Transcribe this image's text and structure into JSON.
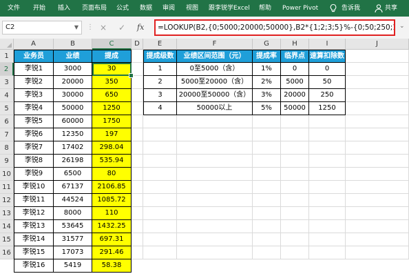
{
  "ribbon": {
    "tabs": [
      "文件",
      "开始",
      "插入",
      "页面布局",
      "公式",
      "数据",
      "审阅",
      "视图",
      "跟李锐学Excel",
      "帮助",
      "Power Pivot"
    ],
    "tell_me": "告诉我",
    "share": "共享",
    "color": "#217346"
  },
  "formula_bar": {
    "name_box": "C2",
    "cancel_icon": "×",
    "confirm_icon": "✓",
    "fx_label": "fx",
    "formula": "=LOOKUP(B2,{0;5000;20000;50000},B2*{1;2;3;5}%-{0;50;250;1250})"
  },
  "columns": [
    "A",
    "B",
    "C",
    "D",
    "E",
    "F",
    "G",
    "H",
    "I",
    "J"
  ],
  "rows": [
    "1",
    "2",
    "3",
    "4",
    "5",
    "6",
    "7",
    "8",
    "9",
    "10",
    "11",
    "12",
    "13",
    "14",
    "15",
    "16"
  ],
  "table1": {
    "headers": [
      "业务员",
      "业绩",
      "提成"
    ],
    "data": [
      [
        "李锐1",
        "3000",
        "30"
      ],
      [
        "李锐2",
        "20000",
        "350"
      ],
      [
        "李锐3",
        "30000",
        "650"
      ],
      [
        "李锐4",
        "50000",
        "1250"
      ],
      [
        "李锐5",
        "60000",
        "1750"
      ],
      [
        "李锐6",
        "12350",
        "197"
      ],
      [
        "李锐7",
        "17402",
        "298.04"
      ],
      [
        "李锐8",
        "26198",
        "535.94"
      ],
      [
        "李锐9",
        "6500",
        "80"
      ],
      [
        "李锐10",
        "67137",
        "2106.85"
      ],
      [
        "李锐11",
        "44524",
        "1085.72"
      ],
      [
        "李锐12",
        "8000",
        "110"
      ],
      [
        "李锐13",
        "53645",
        "1432.25"
      ],
      [
        "李锐14",
        "31577",
        "697.31"
      ],
      [
        "李锐15",
        "17073",
        "291.46"
      ],
      [
        "李锐16",
        "5419",
        "58.38"
      ]
    ]
  },
  "table2": {
    "headers": [
      "提成级数",
      "业绩区间范围（元）",
      "提成率",
      "临界点",
      "速算扣除数"
    ],
    "data": [
      [
        "1",
        "0至5000（含）",
        "1%",
        "0",
        "0"
      ],
      [
        "2",
        "5000至20000（含）",
        "2%",
        "5000",
        "50"
      ],
      [
        "3",
        "20000至50000（含）",
        "3%",
        "20000",
        "250"
      ],
      [
        "4",
        "50000以上",
        "5%",
        "50000",
        "1250"
      ]
    ]
  },
  "colors": {
    "header_fill": "#1f9fd9",
    "highlight_fill": "#ffff00",
    "formula_border": "#e02020"
  }
}
